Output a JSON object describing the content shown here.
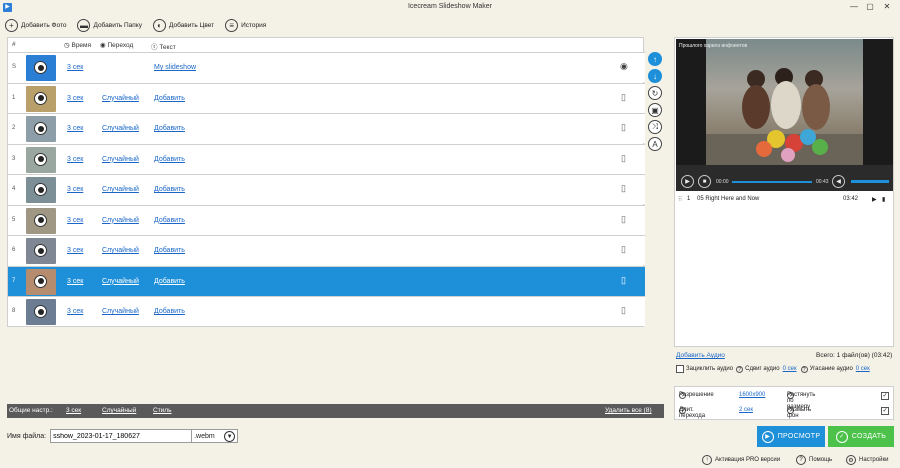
{
  "window": {
    "title": "Icecream Slideshow Maker",
    "min": "—",
    "max": "▢",
    "close": "✕"
  },
  "toolbar": {
    "add_photo": "Добавить Фото",
    "add_folder": "Добавить Папку",
    "add_color": "Добавить Цвет",
    "history": "История"
  },
  "table": {
    "headers": {
      "num": "#",
      "time": "Время",
      "transition": "Переход",
      "text": "Текст"
    },
    "rows": [
      {
        "num": "S",
        "time": "3 сек",
        "transition": "",
        "text": "My slideshow",
        "selected": false,
        "thumb": "#2a7fd4"
      },
      {
        "num": "1",
        "time": "3 сек",
        "transition": "Случайный",
        "text": "Добавить",
        "selected": false,
        "thumb": "#b9a06a"
      },
      {
        "num": "2",
        "time": "3 сек",
        "transition": "Случайный",
        "text": "Добавить",
        "selected": false,
        "thumb": "#8e9ea8"
      },
      {
        "num": "3",
        "time": "3 сек",
        "transition": "Случайный",
        "text": "Добавить",
        "selected": false,
        "thumb": "#9aa7a0"
      },
      {
        "num": "4",
        "time": "3 сек",
        "transition": "Случайный",
        "text": "Добавить",
        "selected": false,
        "thumb": "#7d8f96"
      },
      {
        "num": "5",
        "time": "3 сек",
        "transition": "Случайный",
        "text": "Добавить",
        "selected": false,
        "thumb": "#a09684"
      },
      {
        "num": "6",
        "time": "3 сек",
        "transition": "Случайный",
        "text": "Добавить",
        "selected": false,
        "thumb": "#7f8794"
      },
      {
        "num": "7",
        "time": "3 сек",
        "transition": "Случайный",
        "text": "Добавить",
        "selected": true,
        "thumb": "#b58d6e"
      },
      {
        "num": "8",
        "time": "3 сек",
        "transition": "Случайный",
        "text": "Добавить",
        "selected": false,
        "thumb": "#6b7c93"
      }
    ]
  },
  "bottom_bar": {
    "general": "Общие настр.:",
    "time": "3 сек",
    "transition": "Случайный",
    "style": "Стиль",
    "delete_all": "Удалить все (8)"
  },
  "file": {
    "label": "Имя файла:",
    "name": "sshow_2023-01-17_180627",
    "ext": ".webm"
  },
  "preview": {
    "caption": "Прошлого харилэ инфоинтов",
    "time_current": "00:00",
    "time_total": "00:43",
    "progress": 0,
    "volume": 1
  },
  "track": {
    "index": "1",
    "name": "05 Right Here and Now",
    "duration": "03:42"
  },
  "audio": {
    "add_audio": "Добавить Аудио",
    "total": "Всего: 1 файл(ов) (03:42)",
    "loop": "Зациклить аудио",
    "shift": "Сдвиг аудио",
    "shift_value": "0 сек",
    "fade": "Угасание аудио",
    "fade_value": "0 сек"
  },
  "settings": {
    "resolution": "Разрешение",
    "resolution_value": "1600x900",
    "stretch": "Растянуть по размеру",
    "transition_length": "Длит. перехода",
    "transition_value": "2 сек",
    "blur": "Размыть фон"
  },
  "buttons": {
    "preview": "ПРОСМОТР",
    "create": "СОЗДАТЬ"
  },
  "footer": {
    "pro": "Активация PRO версии",
    "help": "Помощь",
    "settings": "Настройки"
  },
  "colors": {
    "accent": "#1e8fd9",
    "create": "#4cc24a",
    "bottom_bar": "#5a5a5a"
  }
}
